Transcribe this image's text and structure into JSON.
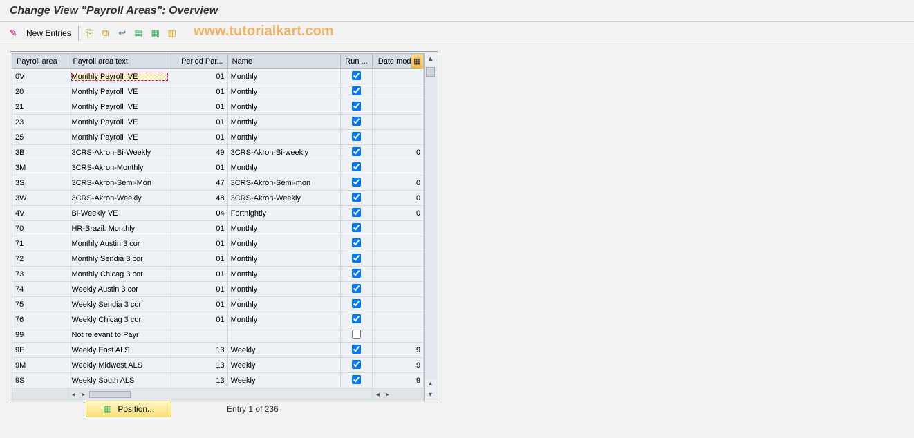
{
  "title": "Change View \"Payroll Areas\": Overview",
  "toolbar": {
    "new_entries": "New Entries"
  },
  "columns": {
    "area": "Payroll area",
    "text": "Payroll area text",
    "per": "Period Par...",
    "name": "Name",
    "run": "Run ...",
    "date": "Date modi..."
  },
  "rows": [
    {
      "area": "0V",
      "text": "Monthly Payroll  VE",
      "per": "01",
      "name": "Monthly",
      "run": true,
      "date": "",
      "sel": true
    },
    {
      "area": "20",
      "text": "Monthly Payroll  VE",
      "per": "01",
      "name": "Monthly",
      "run": true,
      "date": ""
    },
    {
      "area": "21",
      "text": "Monthly Payroll  VE",
      "per": "01",
      "name": "Monthly",
      "run": true,
      "date": ""
    },
    {
      "area": "23",
      "text": "Monthly Payroll  VE",
      "per": "01",
      "name": "Monthly",
      "run": true,
      "date": ""
    },
    {
      "area": "25",
      "text": "Monthly Payroll  VE",
      "per": "01",
      "name": "Monthly",
      "run": true,
      "date": ""
    },
    {
      "area": "3B",
      "text": "3CRS-Akron-Bi-Weekly",
      "per": "49",
      "name": "3CRS-Akron-Bi-weekly",
      "run": true,
      "date": "0"
    },
    {
      "area": "3M",
      "text": "3CRS-Akron-Monthly",
      "per": "01",
      "name": "Monthly",
      "run": true,
      "date": ""
    },
    {
      "area": "3S",
      "text": "3CRS-Akron-Semi-Mon",
      "per": "47",
      "name": "3CRS-Akron-Semi-mon",
      "run": true,
      "date": "0"
    },
    {
      "area": "3W",
      "text": "3CRS-Akron-Weekly",
      "per": "48",
      "name": "3CRS-Akron-Weekly",
      "run": true,
      "date": "0"
    },
    {
      "area": "4V",
      "text": "Bi-Weekly VE",
      "per": "04",
      "name": "Fortnightly",
      "run": true,
      "date": "0"
    },
    {
      "area": "70",
      "text": "HR-Brazil: Monthly",
      "per": "01",
      "name": "Monthly",
      "run": true,
      "date": ""
    },
    {
      "area": "71",
      "text": "Monthly Austin 3 cor",
      "per": "01",
      "name": "Monthly",
      "run": true,
      "date": ""
    },
    {
      "area": "72",
      "text": "Monthly Sendia 3 cor",
      "per": "01",
      "name": "Monthly",
      "run": true,
      "date": ""
    },
    {
      "area": "73",
      "text": "Monthly Chicag 3 cor",
      "per": "01",
      "name": "Monthly",
      "run": true,
      "date": ""
    },
    {
      "area": "74",
      "text": "Weekly Austin 3 cor",
      "per": "01",
      "name": "Monthly",
      "run": true,
      "date": ""
    },
    {
      "area": "75",
      "text": "Weekly Sendia 3 cor",
      "per": "01",
      "name": "Monthly",
      "run": true,
      "date": ""
    },
    {
      "area": "76",
      "text": "Weekly Chicag 3 cor",
      "per": "01",
      "name": "Monthly",
      "run": true,
      "date": ""
    },
    {
      "area": "99",
      "text": "Not relevant to Payr",
      "per": "",
      "name": "",
      "run": false,
      "date": ""
    },
    {
      "area": "9E",
      "text": "Weekly East ALS",
      "per": "13",
      "name": "Weekly",
      "run": true,
      "date": "9"
    },
    {
      "area": "9M",
      "text": "Weekly Midwest ALS",
      "per": "13",
      "name": "Weekly",
      "run": true,
      "date": "9"
    },
    {
      "area": "9S",
      "text": "Weekly South ALS",
      "per": "13",
      "name": "Weekly",
      "run": true,
      "date": "9"
    }
  ],
  "footer": {
    "position": "Position...",
    "entry_info": "Entry 1 of 236"
  },
  "watermark": "www.tutorialkart.com"
}
